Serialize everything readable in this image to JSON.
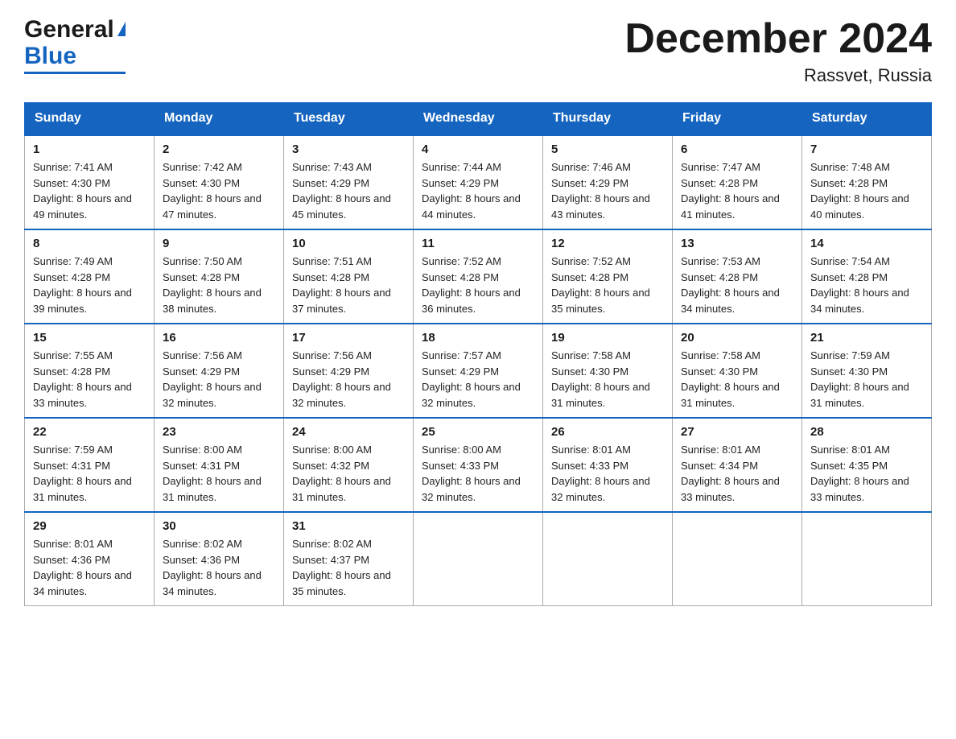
{
  "logo": {
    "general": "General",
    "blue": "Blue"
  },
  "header": {
    "title": "December 2024",
    "location": "Rassvet, Russia"
  },
  "days_of_week": [
    "Sunday",
    "Monday",
    "Tuesday",
    "Wednesday",
    "Thursday",
    "Friday",
    "Saturday"
  ],
  "weeks": [
    [
      {
        "day": "1",
        "sunrise": "7:41 AM",
        "sunset": "4:30 PM",
        "daylight": "8 hours and 49 minutes."
      },
      {
        "day": "2",
        "sunrise": "7:42 AM",
        "sunset": "4:30 PM",
        "daylight": "8 hours and 47 minutes."
      },
      {
        "day": "3",
        "sunrise": "7:43 AM",
        "sunset": "4:29 PM",
        "daylight": "8 hours and 45 minutes."
      },
      {
        "day": "4",
        "sunrise": "7:44 AM",
        "sunset": "4:29 PM",
        "daylight": "8 hours and 44 minutes."
      },
      {
        "day": "5",
        "sunrise": "7:46 AM",
        "sunset": "4:29 PM",
        "daylight": "8 hours and 43 minutes."
      },
      {
        "day": "6",
        "sunrise": "7:47 AM",
        "sunset": "4:28 PM",
        "daylight": "8 hours and 41 minutes."
      },
      {
        "day": "7",
        "sunrise": "7:48 AM",
        "sunset": "4:28 PM",
        "daylight": "8 hours and 40 minutes."
      }
    ],
    [
      {
        "day": "8",
        "sunrise": "7:49 AM",
        "sunset": "4:28 PM",
        "daylight": "8 hours and 39 minutes."
      },
      {
        "day": "9",
        "sunrise": "7:50 AM",
        "sunset": "4:28 PM",
        "daylight": "8 hours and 38 minutes."
      },
      {
        "day": "10",
        "sunrise": "7:51 AM",
        "sunset": "4:28 PM",
        "daylight": "8 hours and 37 minutes."
      },
      {
        "day": "11",
        "sunrise": "7:52 AM",
        "sunset": "4:28 PM",
        "daylight": "8 hours and 36 minutes."
      },
      {
        "day": "12",
        "sunrise": "7:52 AM",
        "sunset": "4:28 PM",
        "daylight": "8 hours and 35 minutes."
      },
      {
        "day": "13",
        "sunrise": "7:53 AM",
        "sunset": "4:28 PM",
        "daylight": "8 hours and 34 minutes."
      },
      {
        "day": "14",
        "sunrise": "7:54 AM",
        "sunset": "4:28 PM",
        "daylight": "8 hours and 34 minutes."
      }
    ],
    [
      {
        "day": "15",
        "sunrise": "7:55 AM",
        "sunset": "4:28 PM",
        "daylight": "8 hours and 33 minutes."
      },
      {
        "day": "16",
        "sunrise": "7:56 AM",
        "sunset": "4:29 PM",
        "daylight": "8 hours and 32 minutes."
      },
      {
        "day": "17",
        "sunrise": "7:56 AM",
        "sunset": "4:29 PM",
        "daylight": "8 hours and 32 minutes."
      },
      {
        "day": "18",
        "sunrise": "7:57 AM",
        "sunset": "4:29 PM",
        "daylight": "8 hours and 32 minutes."
      },
      {
        "day": "19",
        "sunrise": "7:58 AM",
        "sunset": "4:30 PM",
        "daylight": "8 hours and 31 minutes."
      },
      {
        "day": "20",
        "sunrise": "7:58 AM",
        "sunset": "4:30 PM",
        "daylight": "8 hours and 31 minutes."
      },
      {
        "day": "21",
        "sunrise": "7:59 AM",
        "sunset": "4:30 PM",
        "daylight": "8 hours and 31 minutes."
      }
    ],
    [
      {
        "day": "22",
        "sunrise": "7:59 AM",
        "sunset": "4:31 PM",
        "daylight": "8 hours and 31 minutes."
      },
      {
        "day": "23",
        "sunrise": "8:00 AM",
        "sunset": "4:31 PM",
        "daylight": "8 hours and 31 minutes."
      },
      {
        "day": "24",
        "sunrise": "8:00 AM",
        "sunset": "4:32 PM",
        "daylight": "8 hours and 31 minutes."
      },
      {
        "day": "25",
        "sunrise": "8:00 AM",
        "sunset": "4:33 PM",
        "daylight": "8 hours and 32 minutes."
      },
      {
        "day": "26",
        "sunrise": "8:01 AM",
        "sunset": "4:33 PM",
        "daylight": "8 hours and 32 minutes."
      },
      {
        "day": "27",
        "sunrise": "8:01 AM",
        "sunset": "4:34 PM",
        "daylight": "8 hours and 33 minutes."
      },
      {
        "day": "28",
        "sunrise": "8:01 AM",
        "sunset": "4:35 PM",
        "daylight": "8 hours and 33 minutes."
      }
    ],
    [
      {
        "day": "29",
        "sunrise": "8:01 AM",
        "sunset": "4:36 PM",
        "daylight": "8 hours and 34 minutes."
      },
      {
        "day": "30",
        "sunrise": "8:02 AM",
        "sunset": "4:36 PM",
        "daylight": "8 hours and 34 minutes."
      },
      {
        "day": "31",
        "sunrise": "8:02 AM",
        "sunset": "4:37 PM",
        "daylight": "8 hours and 35 minutes."
      },
      null,
      null,
      null,
      null
    ]
  ],
  "labels": {
    "sunrise_prefix": "Sunrise: ",
    "sunset_prefix": "Sunset: ",
    "daylight_prefix": "Daylight: "
  }
}
